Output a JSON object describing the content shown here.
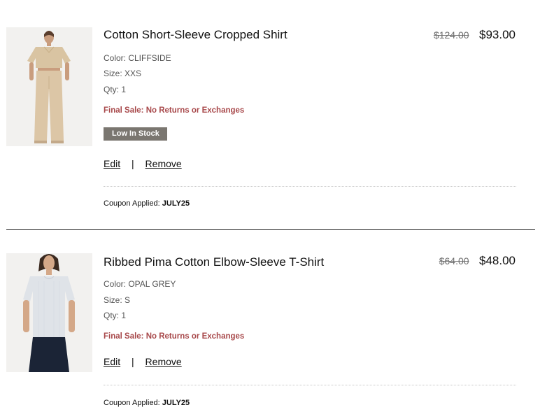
{
  "cart": {
    "items": [
      {
        "title": "Cotton Short-Sleeve Cropped Shirt",
        "price_original": "$124.00",
        "price_sale": "$93.00",
        "color_label": "Color: CLIFFSIDE",
        "size_label": "Size: XXS",
        "qty_label": "Qty: 1",
        "final_sale": "Final Sale: No Returns or Exchanges",
        "stock_badge": "Low In Stock",
        "edit_label": "Edit",
        "separator": "|",
        "remove_label": "Remove",
        "coupon_prefix": "Coupon Applied:",
        "coupon_code": "JULY25",
        "image_alt": "Model wearing tan cropped shirt and tan trousers"
      },
      {
        "title": "Ribbed Pima Cotton Elbow-Sleeve T-Shirt",
        "price_original": "$64.00",
        "price_sale": "$48.00",
        "color_label": "Color: OPAL GREY",
        "size_label": "Size: S",
        "qty_label": "Qty: 1",
        "final_sale": "Final Sale: No Returns or Exchanges",
        "edit_label": "Edit",
        "separator": "|",
        "remove_label": "Remove",
        "coupon_prefix": "Coupon Applied:",
        "coupon_code": "JULY25",
        "image_alt": "Model wearing light grey elbow-sleeve t-shirt and navy skirt"
      }
    ]
  },
  "colors": {
    "final_sale": "#a8494b",
    "stock_badge_bg": "#7a7670",
    "shirt_tan": "#d9c4a2",
    "pants_tan": "#dcc6a6",
    "tshirt_grey": "#dfe3e8",
    "skirt_navy": "#1b2436"
  }
}
